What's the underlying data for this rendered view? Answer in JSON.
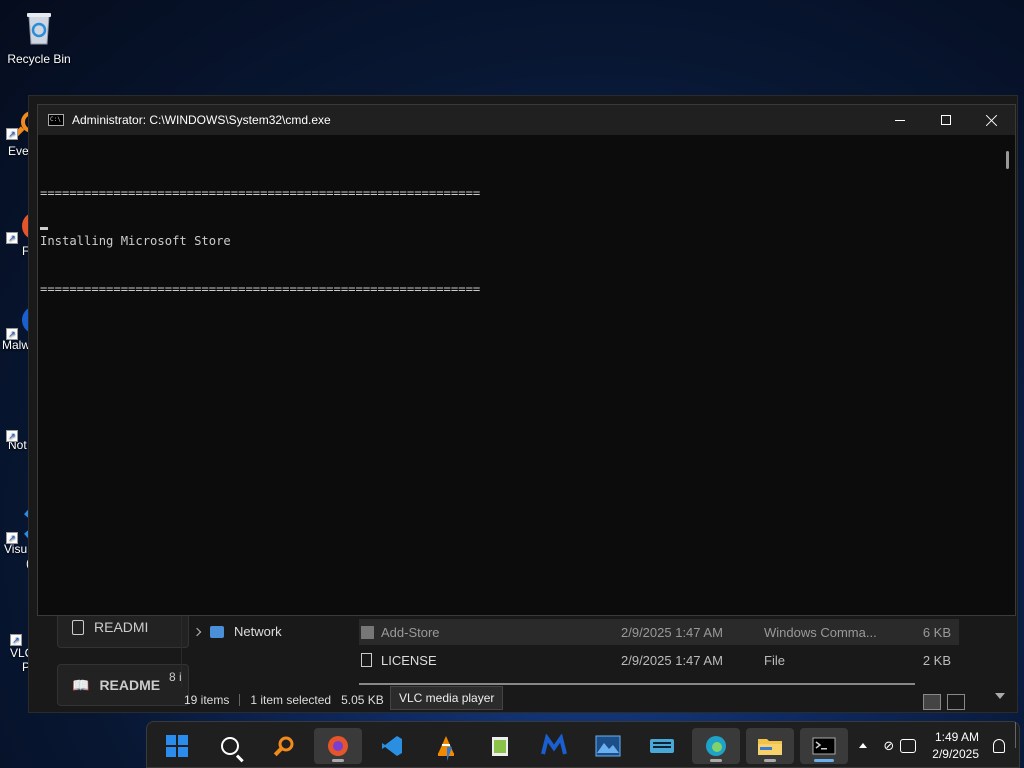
{
  "desktop": {
    "recycle_bin": "Recycle Bin",
    "side_icons": [
      {
        "label": "Eve",
        "icon": "everything-icon",
        "color": "#f08a1c"
      },
      {
        "label": "F",
        "icon": "firefox-icon",
        "color": "#e5552b"
      },
      {
        "label": "Malw",
        "icon": "malwarebytes-icon",
        "color": "#1a5fd0"
      },
      {
        "label": "Not",
        "icon": "notepad-plus-icon",
        "color": "#8bc34a"
      },
      {
        "label": "Visu",
        "icon": "vscode-icon",
        "color": "#2a8fe0"
      },
      {
        "label": "VLC",
        "icon": "vlc-icon",
        "color": "#f28a00"
      }
    ],
    "side_icon_extra": {
      "visu_second": "(",
      "vlc_second": "P"
    }
  },
  "explorer": {
    "readme_items": [
      "READMI",
      "README"
    ],
    "nav": {
      "network": "Network"
    },
    "items_fragment": "8 i",
    "files": [
      {
        "name": "Add-Store",
        "date": "2/9/2025 1:47 AM",
        "type": "Windows Comma...",
        "size": "6 KB"
      },
      {
        "name": "LICENSE",
        "date": "2/9/2025 1:47 AM",
        "type": "File",
        "size": "2 KB"
      }
    ],
    "status": {
      "count": "19 items",
      "selected": "1 item selected",
      "size": "5.05 KB"
    }
  },
  "tooltip": "VLC media player",
  "cmd": {
    "title": "Administrator: C:\\WINDOWS\\System32\\cmd.exe",
    "lines": [
      "============================================================",
      "Installing Microsoft Store",
      "============================================================"
    ]
  },
  "taskbar": {
    "apps": [
      {
        "name": "start",
        "icon": "windows-logo-icon"
      },
      {
        "name": "search",
        "icon": "search-icon"
      },
      {
        "name": "everything",
        "icon": "everything-icon",
        "color": "#f08a1c"
      },
      {
        "name": "firefox",
        "icon": "firefox-icon",
        "color": "#e5552b"
      },
      {
        "name": "vscode",
        "icon": "vscode-icon",
        "color": "#2a8fe0"
      },
      {
        "name": "vlc",
        "icon": "vlc-icon",
        "color": "#f28a00"
      },
      {
        "name": "notepad-plus",
        "icon": "notepad-plus-icon",
        "color": "#8bc34a"
      },
      {
        "name": "malwarebytes",
        "icon": "malwarebytes-icon",
        "color": "#1a5fd0"
      },
      {
        "name": "photo",
        "icon": "photos-icon",
        "color": "#3a8fd8"
      },
      {
        "name": "keyboard",
        "icon": "keyboard-icon",
        "color": "#4aa8d8"
      },
      {
        "name": "edge",
        "icon": "edge-icon",
        "color": "#1fa2c8"
      },
      {
        "name": "explorer",
        "icon": "folder-icon",
        "color": "#f2c24a"
      },
      {
        "name": "cmd",
        "icon": "cmd-icon",
        "color": "#cccccc"
      }
    ],
    "clock": {
      "time": "1:49 AM",
      "date": "2/9/2025"
    }
  }
}
